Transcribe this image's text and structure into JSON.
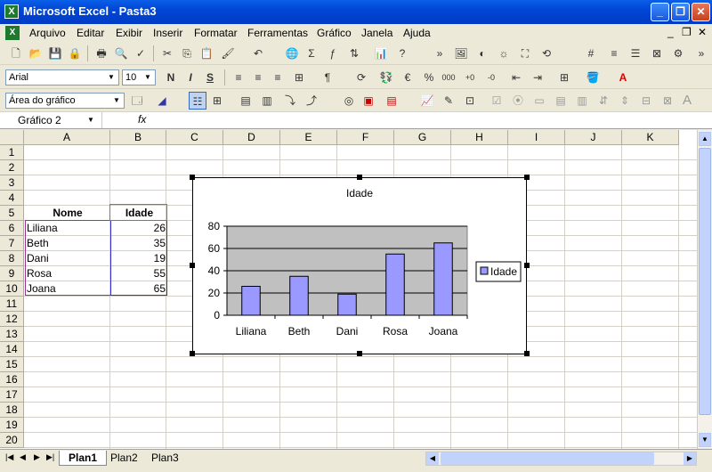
{
  "window": {
    "title": "Microsoft Excel - Pasta3",
    "app_icon": "X"
  },
  "menu": {
    "items": [
      "Arquivo",
      "Editar",
      "Exibir",
      "Inserir",
      "Formatar",
      "Ferramentas",
      "Gráfico",
      "Janela",
      "Ajuda"
    ]
  },
  "format_toolbar": {
    "font": "Arial",
    "size": "10",
    "bold": "N",
    "italic": "I",
    "underline": "S"
  },
  "chart_toolbar": {
    "area": "Área do gráfico"
  },
  "formula_bar": {
    "namebox": "Gráfico 2",
    "fx": "fx",
    "content": ""
  },
  "grid": {
    "columns": [
      "A",
      "B",
      "C",
      "D",
      "E",
      "F",
      "G",
      "H",
      "I",
      "J",
      "K"
    ],
    "rows": [
      "1",
      "2",
      "3",
      "4",
      "5",
      "6",
      "7",
      "8",
      "9",
      "10",
      "11",
      "12",
      "13",
      "14",
      "15",
      "16",
      "17",
      "18",
      "19",
      "20"
    ],
    "header": {
      "a": "Nome",
      "b": "Idade"
    },
    "data": [
      {
        "name": "Liliana",
        "age": "26"
      },
      {
        "name": "Beth",
        "age": "35"
      },
      {
        "name": "Dani",
        "age": "19"
      },
      {
        "name": "Rosa",
        "age": "55"
      },
      {
        "name": "Joana",
        "age": "65"
      }
    ]
  },
  "chart_data": {
    "type": "bar",
    "title": "Idade",
    "categories": [
      "Liliana",
      "Beth",
      "Dani",
      "Rosa",
      "Joana"
    ],
    "series": [
      {
        "name": "Idade",
        "values": [
          26,
          35,
          19,
          55,
          65
        ]
      }
    ],
    "ylim": [
      0,
      80
    ],
    "yticks": [
      "0",
      "20",
      "40",
      "60",
      "80"
    ],
    "grid": true,
    "legend": "right",
    "colors": {
      "bar": "#9999ff",
      "plot": "#c0c0c0"
    }
  },
  "sheets": {
    "tabs": [
      "Plan1",
      "Plan2",
      "Plan3"
    ],
    "active": "Plan1"
  }
}
